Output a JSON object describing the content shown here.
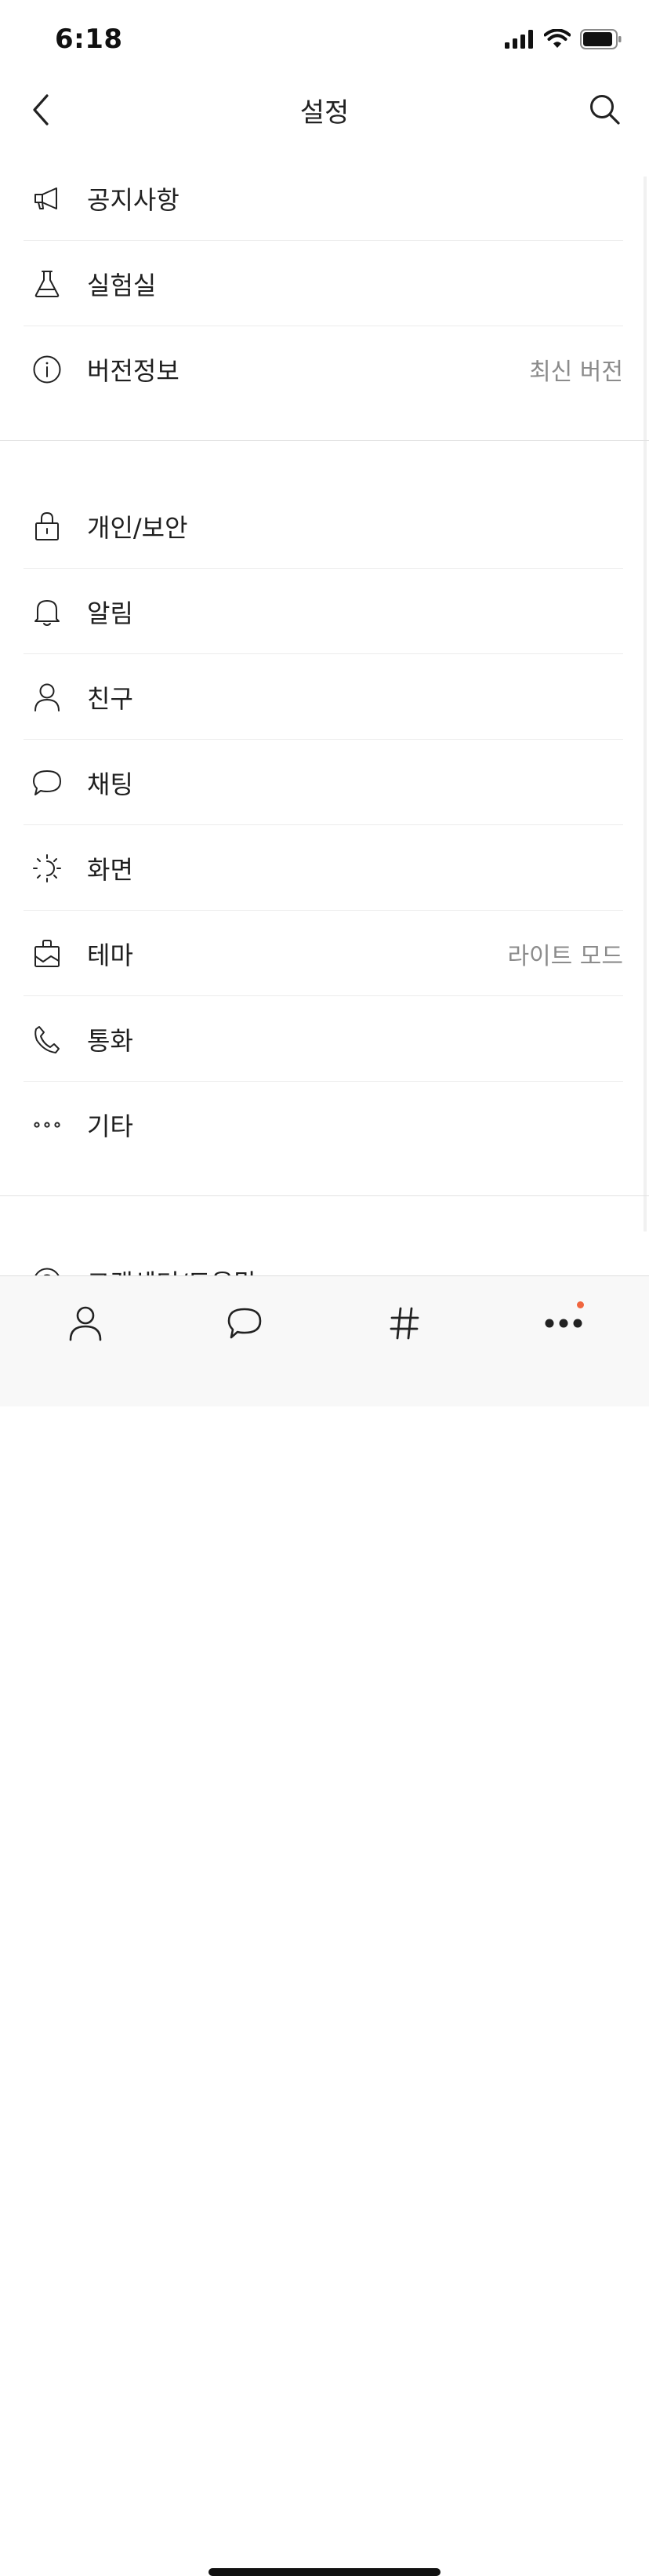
{
  "status_bar": {
    "time": "6:18"
  },
  "header": {
    "title": "설정"
  },
  "sections": [
    {
      "items": [
        {
          "label": "공지사항",
          "icon": "megaphone-icon"
        },
        {
          "label": "실험실",
          "icon": "flask-icon"
        },
        {
          "label": "버전정보",
          "icon": "info-icon",
          "value": "최신 버전"
        }
      ]
    },
    {
      "items": [
        {
          "label": "개인/보안",
          "icon": "lock-icon"
        },
        {
          "label": "알림",
          "icon": "bell-icon"
        },
        {
          "label": "친구",
          "icon": "person-icon"
        },
        {
          "label": "채팅",
          "icon": "chat-bubble-icon"
        },
        {
          "label": "화면",
          "icon": "brightness-icon"
        },
        {
          "label": "테마",
          "icon": "theme-icon",
          "value": "라이트 모드"
        },
        {
          "label": "통화",
          "icon": "phone-icon"
        },
        {
          "label": "기타",
          "icon": "more-icon"
        }
      ]
    },
    {
      "items": [
        {
          "label": "고객센터/도움말",
          "icon": "help-icon"
        }
      ]
    }
  ],
  "tab_bar": {
    "tabs": [
      {
        "name": "friends",
        "icon": "person-icon"
      },
      {
        "name": "chats",
        "icon": "chat-bubble-icon"
      },
      {
        "name": "hashtag",
        "icon": "hashtag-icon"
      },
      {
        "name": "more",
        "icon": "more-icon",
        "badge": true
      }
    ]
  },
  "colors": {
    "badge": "#f0663f",
    "text": "#1f1f1f",
    "secondary_text": "#8b8b8b",
    "divider": "#ececec"
  }
}
